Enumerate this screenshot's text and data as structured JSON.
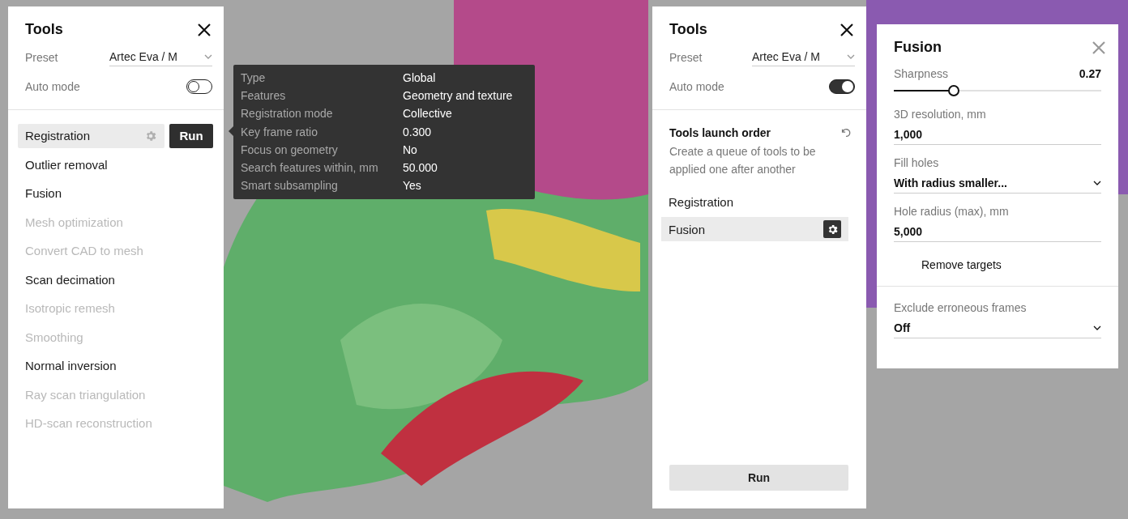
{
  "tools_panel": {
    "title": "Tools",
    "preset_label": "Preset",
    "preset_value": "Artec Eva / M",
    "auto_mode_label": "Auto mode",
    "auto_mode": false,
    "tools": [
      {
        "label": "Registration",
        "disabled": false,
        "selected": true
      },
      {
        "label": "Outlier removal",
        "disabled": false,
        "selected": false
      },
      {
        "label": "Fusion",
        "disabled": false,
        "selected": false
      },
      {
        "label": "Mesh optimization",
        "disabled": true,
        "selected": false
      },
      {
        "label": "Convert CAD to mesh",
        "disabled": true,
        "selected": false
      },
      {
        "label": "Scan decimation",
        "disabled": false,
        "selected": false
      },
      {
        "label": "Isotropic remesh",
        "disabled": true,
        "selected": false
      },
      {
        "label": "Smoothing",
        "disabled": true,
        "selected": false
      },
      {
        "label": "Normal inversion",
        "disabled": false,
        "selected": false
      },
      {
        "label": "Ray scan triangulation",
        "disabled": true,
        "selected": false
      },
      {
        "label": "HD-scan reconstruction",
        "disabled": true,
        "selected": false
      }
    ],
    "run_button": "Run"
  },
  "tooltip": {
    "rows": [
      {
        "label": "Type",
        "value": "Global"
      },
      {
        "label": "Features",
        "value": "Geometry and texture"
      },
      {
        "label": "Registration mode",
        "value": "Collective"
      },
      {
        "label": "Key frame ratio",
        "value": "0.300"
      },
      {
        "label": "Focus on geometry",
        "value": "No"
      },
      {
        "label": "Search features within, mm",
        "value": "50.000"
      },
      {
        "label": "Smart subsampling",
        "value": "Yes"
      }
    ]
  },
  "auto_panel": {
    "title": "Tools",
    "preset_label": "Preset",
    "preset_value": "Artec Eva / M",
    "auto_mode_label": "Auto mode",
    "auto_mode": true,
    "section_title": "Tools launch order",
    "section_text": "Create a queue of tools to be applied one after another",
    "queue": [
      {
        "label": "Registration",
        "selected": false
      },
      {
        "label": "Fusion",
        "selected": true
      }
    ],
    "run_button": "Run"
  },
  "fusion_panel": {
    "title": "Fusion",
    "sharpness_label": "Sharpness",
    "sharpness_value": "0.27",
    "level": 0.29,
    "fields": [
      {
        "kind": "input",
        "label": "3D resolution, mm",
        "value": "1,000"
      },
      {
        "kind": "select",
        "label": "Fill holes",
        "value": "With radius smaller..."
      },
      {
        "kind": "input",
        "label": "Hole radius (max), mm",
        "value": "5,000"
      },
      {
        "kind": "checkbox",
        "label": "Remove targets"
      },
      {
        "kind": "divider"
      },
      {
        "kind": "select",
        "label": "Exclude erroneous frames",
        "value": "Off"
      }
    ]
  }
}
